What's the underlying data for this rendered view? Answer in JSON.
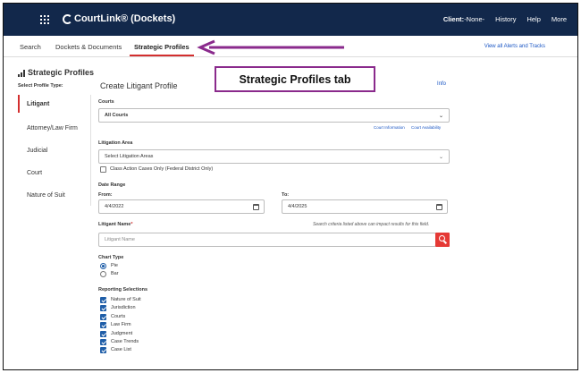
{
  "header": {
    "brand": "CourtLink® (Dockets)",
    "nav": {
      "client_label": "Client:",
      "client_value": "-None-",
      "history": "History",
      "help": "Help",
      "more": "More"
    }
  },
  "tabs": [
    {
      "label": "Search",
      "active": false
    },
    {
      "label": "Dockets & Documents",
      "active": false
    },
    {
      "label": "Strategic Profiles",
      "active": true
    }
  ],
  "alerts_link": "View all Alerts and Tracks",
  "annotation": {
    "callout": "Strategic Profiles tab",
    "color": "#8a2a8c"
  },
  "sidebar": {
    "title": "Strategic Profiles",
    "profile_type_label": "Select Profile Type:",
    "items": [
      {
        "label": "Litigant",
        "active": true
      },
      {
        "label": "Attorney/Law Firm",
        "active": false
      },
      {
        "label": "Judicial",
        "active": false
      },
      {
        "label": "Court",
        "active": false
      },
      {
        "label": "Nature of Suit",
        "active": false
      }
    ]
  },
  "form": {
    "title": "Create Litigant Profile",
    "info": "Info",
    "courts": {
      "label": "Courts",
      "value": "All Courts",
      "links": [
        "Court Information",
        "Court Availability"
      ]
    },
    "litigation_area": {
      "label": "Litigation Area",
      "value": "Select Litigation Areas",
      "class_action": "Class Action Cases Only (Federal District Only)"
    },
    "date_range": {
      "label": "Date Range",
      "from_label": "From:",
      "from_value": "4/4/2022",
      "to_label": "To:",
      "to_value": "4/4/2025"
    },
    "litigant_name": {
      "label": "Litigant Name",
      "required_mark": "*",
      "hint": "Search criteria listed above can impact results for this field.",
      "placeholder": "Litigant Name"
    },
    "chart_type": {
      "label": "Chart Type",
      "options": [
        {
          "label": "Pie",
          "selected": true
        },
        {
          "label": "Bar",
          "selected": false
        }
      ]
    },
    "reporting": {
      "label": "Reporting Selections",
      "items": [
        {
          "label": "Nature of Suit",
          "checked": true
        },
        {
          "label": "Jurisdiction",
          "checked": true
        },
        {
          "label": "Courts",
          "checked": true
        },
        {
          "label": "Law Firm",
          "checked": true
        },
        {
          "label": "Judgment",
          "checked": true
        },
        {
          "label": "Case Trends",
          "checked": true
        },
        {
          "label": "Case List",
          "checked": true
        }
      ]
    }
  },
  "colors": {
    "topbar": "#12284b",
    "accent_red": "#d32f2f",
    "link_blue": "#1a56c4",
    "check_blue": "#1f5ea8"
  }
}
